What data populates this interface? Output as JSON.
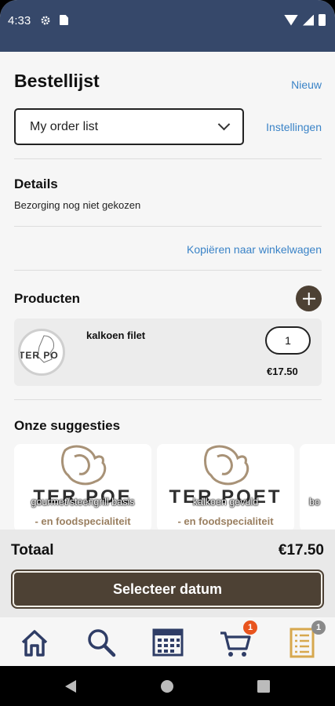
{
  "status_bar": {
    "time": "4:33"
  },
  "header": {
    "title": "Bestellijst",
    "new_link": "Nieuw"
  },
  "order_list": {
    "selected": "My order list",
    "settings_link": "Instellingen"
  },
  "details": {
    "heading": "Details",
    "subtext": "Bezorging nog niet gekozen",
    "copy_link": "Kopiëren naar winkelwagen"
  },
  "products": {
    "heading": "Producten",
    "items": [
      {
        "name": "kalkoen filet",
        "quantity": "1",
        "price": "€17.50",
        "thumb_text": "TER PO"
      }
    ]
  },
  "suggestions": {
    "heading": "Onze suggesties",
    "items": [
      {
        "label": "gourmet/steengrill basis",
        "logo_text": "TER POE",
        "logo_sub": "- en foodspecialiteit"
      },
      {
        "label": "kalkoen gevuld",
        "logo_text": "TER POET",
        "logo_sub": "- en foodspecialiteit"
      },
      {
        "label": "bo",
        "logo_text": "",
        "logo_sub": ""
      }
    ]
  },
  "total": {
    "label": "Totaal",
    "value": "€17.50"
  },
  "primary_button": {
    "label": "Selecteer datum"
  },
  "bottom_nav": {
    "items": [
      {
        "name": "home",
        "icon": "home-icon"
      },
      {
        "name": "search",
        "icon": "search-icon"
      },
      {
        "name": "calendar",
        "icon": "calendar-icon"
      },
      {
        "name": "cart",
        "icon": "cart-icon",
        "badge": "1"
      },
      {
        "name": "order-list",
        "icon": "list-icon",
        "badge": "1"
      }
    ]
  },
  "colors": {
    "header_bg": "#36486a",
    "accent_brown": "#4d4134",
    "link_blue": "#3a83c7",
    "badge_orange": "#e8541e",
    "badge_gray": "#8a8a8a",
    "nav_icon": "#2f3d66",
    "list_icon": "#d7a84e"
  }
}
